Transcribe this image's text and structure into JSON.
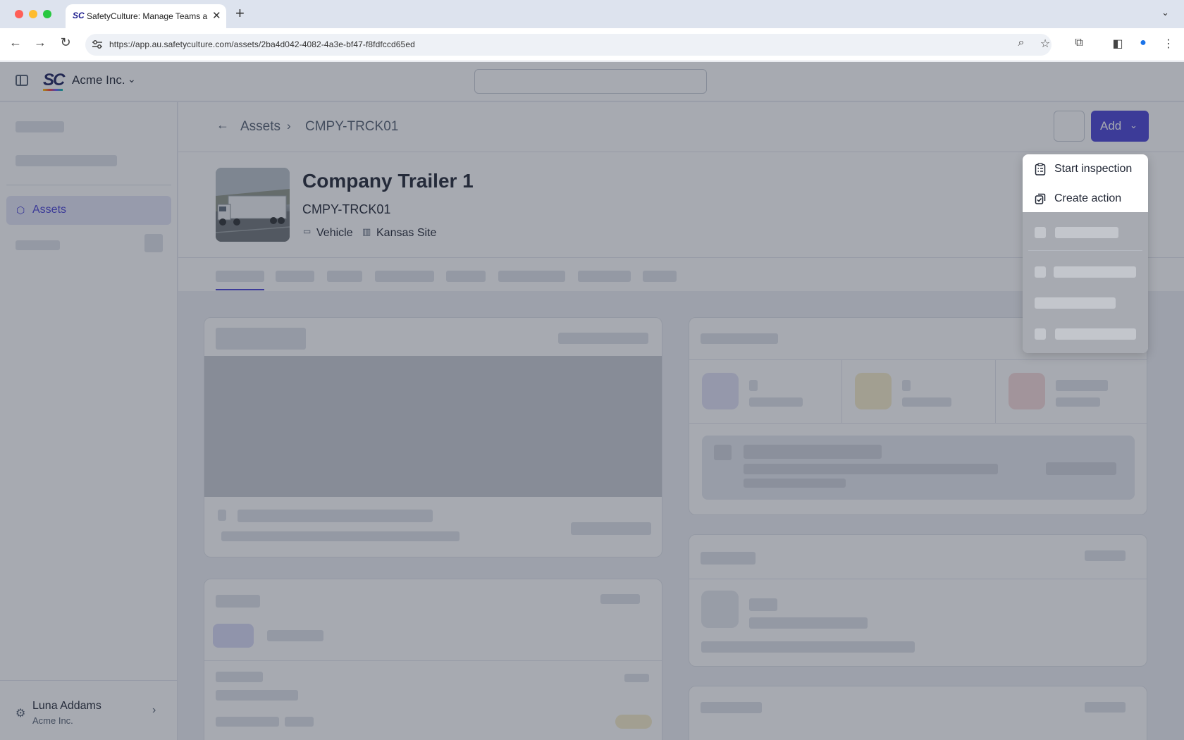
{
  "browser": {
    "tab_title": "SafetyCulture: Manage Teams and...",
    "tab_favicon": "SC",
    "url": "https://app.au.safetyculture.com/assets/2ba4d042-4082-4a3e-bf47-f8fdfccd65ed"
  },
  "header": {
    "logo_text": "SC",
    "org_name": "Acme Inc."
  },
  "sidebar": {
    "active_item": "Assets",
    "user_name": "Luna Addams",
    "user_org": "Acme Inc."
  },
  "breadcrumb": {
    "parent": "Assets",
    "current": "CMPY-TRCK01"
  },
  "toolbar": {
    "add_label": "Add"
  },
  "asset": {
    "title": "Company Trailer 1",
    "code": "CMPY-TRCK01",
    "type": "Vehicle",
    "site": "Kansas Site"
  },
  "dropdown": {
    "items": [
      {
        "label": "Start inspection",
        "icon": "clipboard-icon"
      },
      {
        "label": "Create action",
        "icon": "action-icon"
      }
    ]
  },
  "colors": {
    "accent": "#4740d4"
  }
}
